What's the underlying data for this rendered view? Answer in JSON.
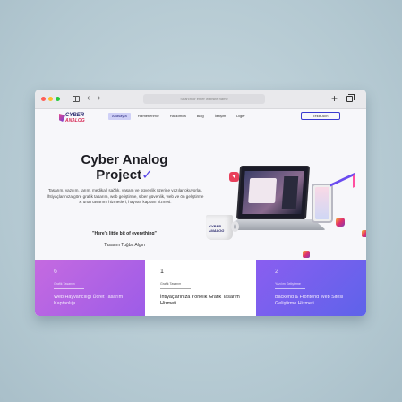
{
  "browser": {
    "url_placeholder": "Search or enter website name"
  },
  "site": {
    "logo_line1": "CYBER",
    "logo_line2": "ANALOG",
    "menu": [
      "Anasayfa",
      "Hizmetlerimiz",
      "Hakkımda",
      "Blog",
      "İletişim",
      "Diğer"
    ],
    "cta": "Teklif Alın",
    "hero": {
      "title_line1": "Cyber Analog",
      "title_line2": "Project",
      "title_mark": "✓",
      "paragraph": "Tasarım, yazılım, tarım, medikal, sağlık, yaşam ve güvenlik üzerine yazılar okuyorlar. İhtiyaçlarınıza göre grafik tasarım, web geliştirme, siber güvenlik, web ve ön geliştirme & ürün tasarımı hizmetleri, hayvan kaptanı hizmeti.",
      "quote": "\"Here's little bit of everything\"",
      "signature": "Tasarım Tuğba Algın"
    },
    "mug_label": "CYBER ANALOG",
    "cards": [
      {
        "num": "6",
        "small": "Grafik Tasarımı",
        "text": "Web Hayvancılığı Ücret Tasarım Kaptanlığı"
      },
      {
        "num": "1",
        "small": "Grafik Tasarım",
        "text": "İhtiyaçlarınıza Yönelik Grafik Tasarım Hizmeti"
      },
      {
        "num": "2",
        "small": "Yazılım Geliştirme",
        "text": "Backend & Frontend Web Sitesi Geliştirme Hizmeti"
      }
    ]
  }
}
